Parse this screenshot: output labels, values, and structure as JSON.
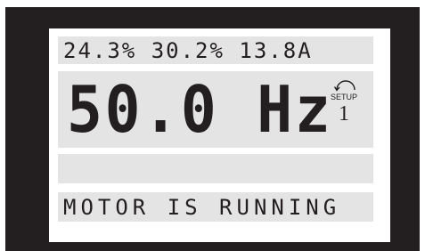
{
  "display": {
    "status_line": "24.3% 30.2% 13.8A",
    "main_value": "50.0 Hz",
    "setup_label": "SETUP",
    "setup_number": "1",
    "setup_icon": "rotate-arrow-icon",
    "empty_line": "",
    "message_line": "MOTOR IS RUNNING"
  },
  "colors": {
    "bezel": "#231f20",
    "screen": "#ffffff",
    "row_background": "#e4e4e4",
    "text": "#231f20"
  }
}
